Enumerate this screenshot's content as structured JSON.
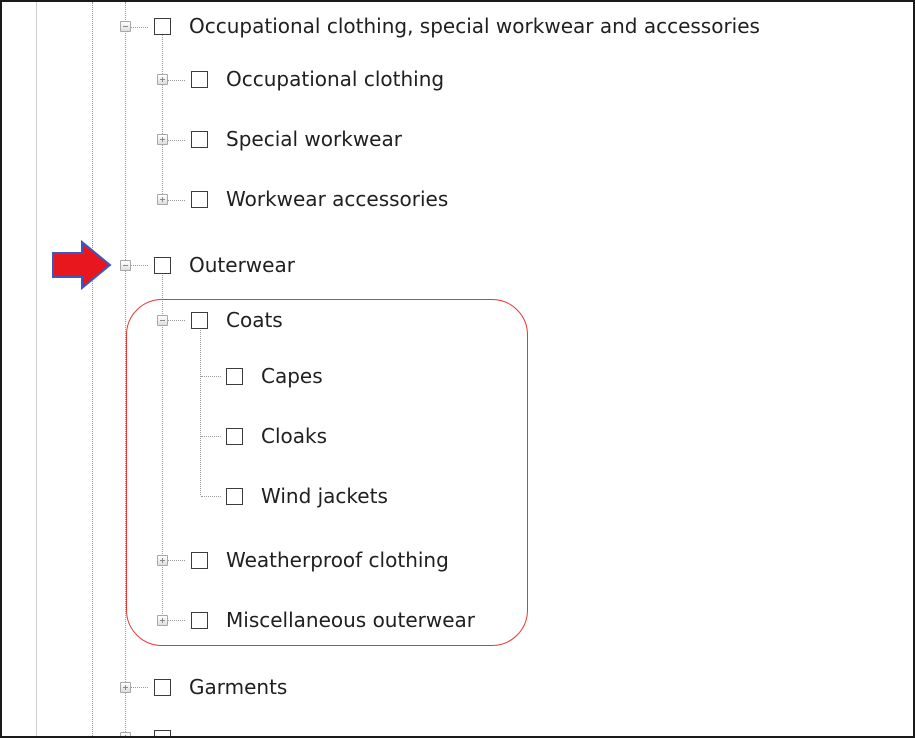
{
  "tree": {
    "nodes": [
      {
        "id": "occupational-root",
        "label": "Occupational clothing, special workwear and accessories",
        "expander": "expanded"
      },
      {
        "id": "occupational-clothing",
        "label": "Occupational clothing",
        "expander": "collapsed"
      },
      {
        "id": "special-workwear",
        "label": "Special workwear",
        "expander": "collapsed"
      },
      {
        "id": "workwear-accessories",
        "label": "Workwear accessories",
        "expander": "collapsed"
      },
      {
        "id": "outerwear",
        "label": "Outerwear",
        "expander": "expanded"
      },
      {
        "id": "coats",
        "label": "Coats",
        "expander": "expanded"
      },
      {
        "id": "capes",
        "label": "Capes",
        "expander": "none"
      },
      {
        "id": "cloaks",
        "label": "Cloaks",
        "expander": "none"
      },
      {
        "id": "wind-jackets",
        "label": "Wind jackets",
        "expander": "none"
      },
      {
        "id": "weatherproof-clothing",
        "label": "Weatherproof clothing",
        "expander": "collapsed"
      },
      {
        "id": "misc-outerwear",
        "label": "Miscellaneous outerwear",
        "expander": "collapsed"
      },
      {
        "id": "garments",
        "label": "Garments",
        "expander": "collapsed"
      }
    ]
  },
  "annotations": {
    "arrow_color": "#e8171d",
    "arrow_outline": "#3a57c4",
    "highlight_color": "#e53935"
  }
}
